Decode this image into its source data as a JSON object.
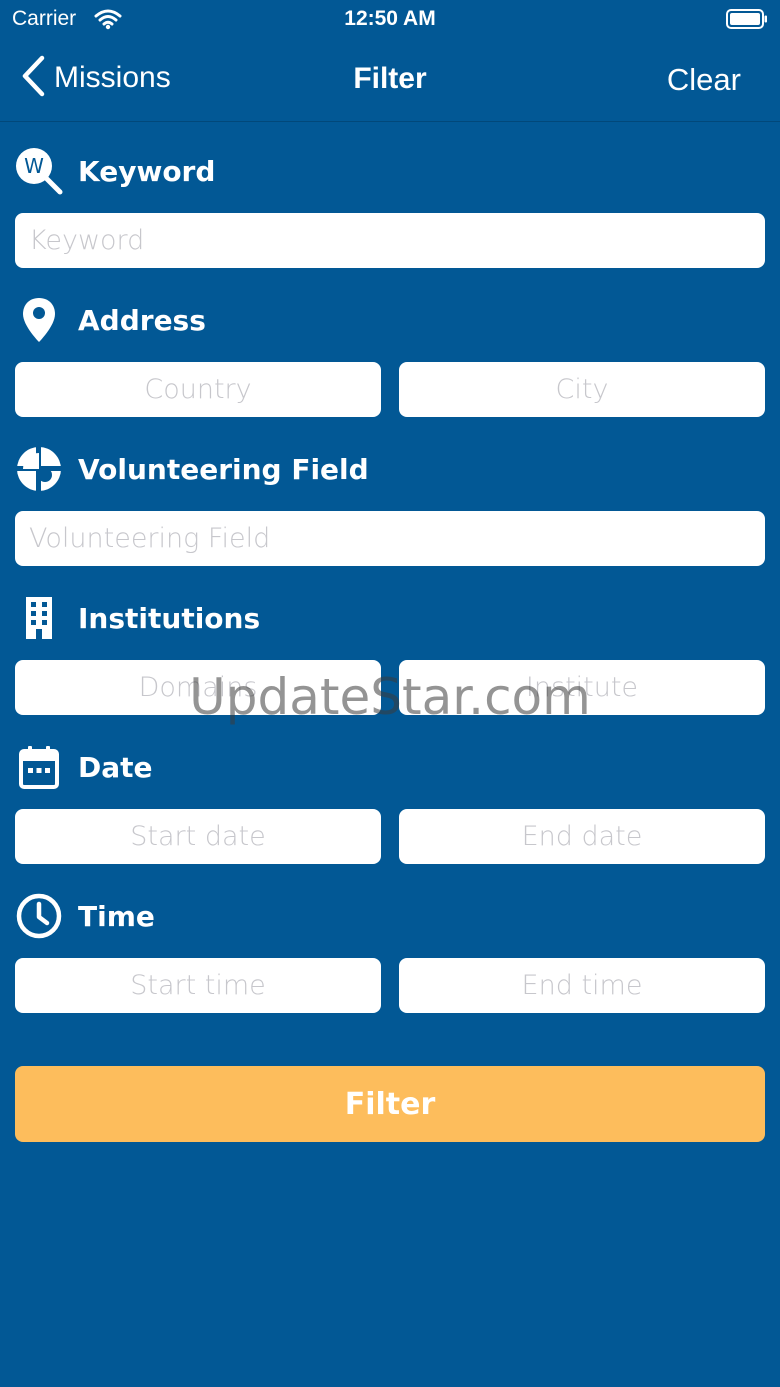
{
  "status_bar": {
    "carrier": "Carrier",
    "time": "12:50 AM"
  },
  "nav": {
    "back_label": "Missions",
    "title": "Filter",
    "clear_label": "Clear"
  },
  "sections": {
    "keyword": {
      "label": "Keyword",
      "icon": "keyword-search-icon",
      "placeholder": "Keyword"
    },
    "address": {
      "label": "Address",
      "icon": "location-pin-icon",
      "country_placeholder": "Country",
      "city_placeholder": "City"
    },
    "volunteering_field": {
      "label": "Volunteering Field",
      "icon": "pie-chart-icon",
      "placeholder": "Volunteering Field"
    },
    "institutions": {
      "label": "Institutions",
      "icon": "building-icon",
      "domains_placeholder": "Domains",
      "institute_placeholder": "Institute"
    },
    "date": {
      "label": "Date",
      "icon": "calendar-icon",
      "start_placeholder": "Start date",
      "end_placeholder": "End date"
    },
    "time": {
      "label": "Time",
      "icon": "clock-icon",
      "start_placeholder": "Start time",
      "end_placeholder": "End time"
    }
  },
  "filter_button_label": "Filter",
  "watermark": "UpdateStar.com",
  "colors": {
    "background": "#025895",
    "accent_button": "#fdbd5c",
    "field_background": "#ffffff",
    "placeholder": "#c7c7cc"
  }
}
